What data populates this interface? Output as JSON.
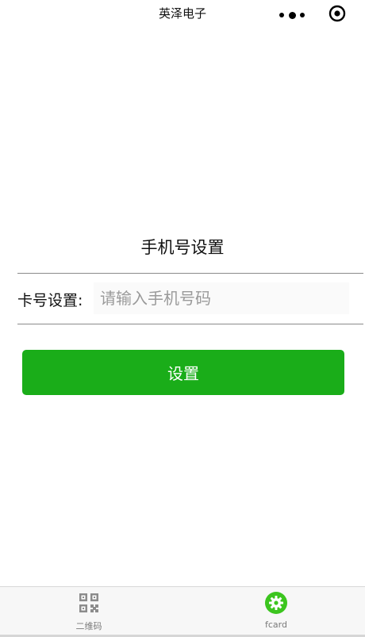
{
  "nav": {
    "title": "英泽电子",
    "more_icon": "more-dots-icon",
    "close_icon": "target-circle-icon"
  },
  "main": {
    "title": "手机号设置",
    "field_label": "卡号设置:",
    "field_placeholder": "请输入手机号码",
    "field_value": "",
    "submit_label": "设置"
  },
  "tabbar": {
    "items": [
      {
        "label": "二维码",
        "icon": "qr-code-icon"
      },
      {
        "label": "fcard",
        "icon": "gear-icon"
      }
    ]
  },
  "colors": {
    "button": "#1aad19",
    "tab_label": "#7a7a7a",
    "gear_icon": "#3cc51f"
  }
}
